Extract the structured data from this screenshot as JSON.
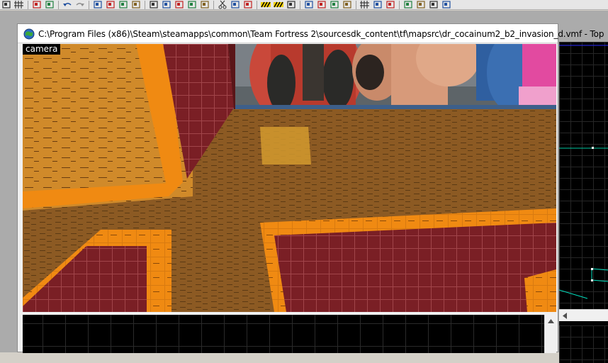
{
  "toolbar": {
    "icons": [
      "select-icon",
      "grid-icon",
      "group-select-icon",
      "object-select-icon",
      "undo-icon",
      "redo-icon",
      "carve-icon",
      "texture-group-icon",
      "texture-lock-icon",
      "ignore-groups-icon",
      "entity-icon",
      "brush-icon",
      "overlay-icon",
      "clip-icon",
      "vertex-icon",
      "cut-icon",
      "copy-icon",
      "paste-icon",
      "hazard-toggle-icon",
      "hazard-icon",
      "run-map-icon",
      "decal-icon",
      "clip-tool-icon",
      "vertex-tool-icon",
      "apply-texture-icon",
      "toggle-3d-grid-icon",
      "toggle-models-icon",
      "toggle-lighting-icon",
      "ladder-icon",
      "axis-icon",
      "hammer-icon",
      "magnify-icon"
    ]
  },
  "window": {
    "title": "C:\\Program Files (x86)\\Steam\\steamapps\\common\\Team Fortress 2\\sourcesdk_content\\tf\\mapsrc\\dr_cocainum2_b2_invasion_d.vmf - Top"
  },
  "camera_view": {
    "label": "camera"
  },
  "colors": {
    "floor": "#8c5a23",
    "wall_red": "#7a1f25",
    "trim_orange": "#f58a0a",
    "viewport_bg": "#000000",
    "grid_line": "#2a2a2a",
    "brush_outline": "#00e0c0"
  }
}
